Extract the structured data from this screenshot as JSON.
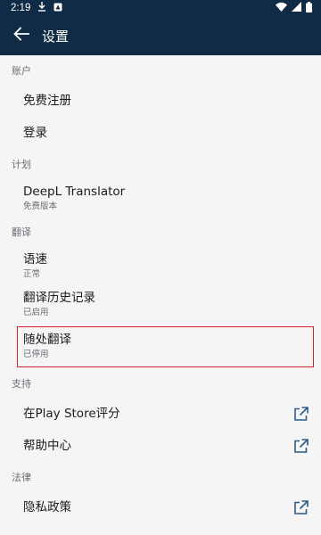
{
  "status_bar": {
    "time": "2:19"
  },
  "app_bar": {
    "title": "设置"
  },
  "sections": {
    "account": {
      "header": "账户",
      "signup": "免费注册",
      "login": "登录"
    },
    "plan": {
      "header": "计划",
      "translator": {
        "title": "DeepL Translator",
        "subtitle": "免费版本"
      }
    },
    "translate": {
      "header": "翻译",
      "speed": {
        "title": "语速",
        "subtitle": "正常"
      },
      "history": {
        "title": "翻译历史记录",
        "subtitle": "已启用"
      },
      "anywhere": {
        "title": "随处翻译",
        "subtitle": "已停用"
      }
    },
    "support": {
      "header": "支持",
      "rate": "在Play Store评分",
      "help": "帮助中心"
    },
    "legal": {
      "header": "法律",
      "privacy": "隐私政策"
    }
  },
  "icons": {
    "back": "arrow-left-icon",
    "external": "open-external-icon",
    "wifi": "wifi-icon",
    "signal": "signal-icon",
    "battery": "battery-icon",
    "download": "download-icon"
  },
  "colors": {
    "app_bar": "#0f2b45",
    "background": "#f5f5f6",
    "highlight_border": "#d4202b",
    "external_icon": "#2d5c86"
  }
}
